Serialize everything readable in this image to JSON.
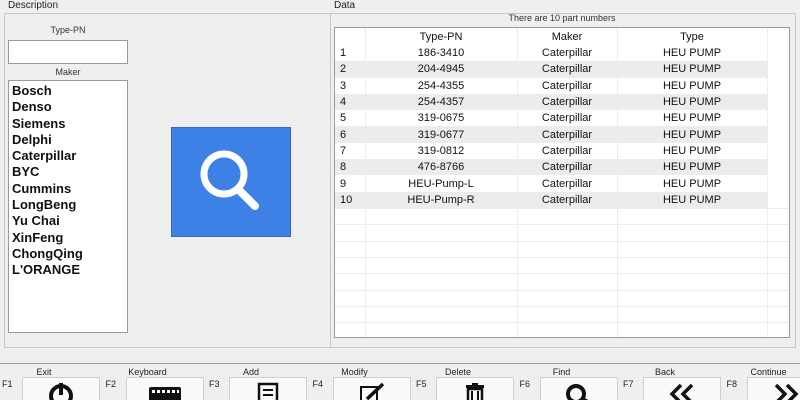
{
  "description_panel": {
    "title": "Description",
    "type_pn_label": "Type-PN",
    "type_pn_value": "",
    "maker_label": "Maker",
    "makers": [
      "Bosch",
      "Denso",
      "Siemens",
      "Delphi",
      "Caterpillar",
      "BYC",
      "Cummins",
      "LongBeng",
      "Yu Chai",
      "XinFeng",
      "ChongQing",
      "L'ORANGE"
    ]
  },
  "search_button": {
    "icon": "magnifier-icon",
    "color": "#3d80e6"
  },
  "data_panel": {
    "title": "Data",
    "count_text": "There are 10 part numbers",
    "columns": [
      "",
      "Type-PN",
      "Maker",
      "Type"
    ],
    "rows": [
      [
        "1",
        "186-3410",
        "Caterpillar",
        "HEU PUMP"
      ],
      [
        "2",
        "204-4945",
        "Caterpillar",
        "HEU PUMP"
      ],
      [
        "3",
        "254-4355",
        "Caterpillar",
        "HEU PUMP"
      ],
      [
        "4",
        "254-4357",
        "Caterpillar",
        "HEU PUMP"
      ],
      [
        "5",
        "319-0675",
        "Caterpillar",
        "HEU PUMP"
      ],
      [
        "6",
        "319-0677",
        "Caterpillar",
        "HEU PUMP"
      ],
      [
        "7",
        "319-0812",
        "Caterpillar",
        "HEU PUMP"
      ],
      [
        "8",
        "476-8766",
        "Caterpillar",
        "HEU PUMP"
      ],
      [
        "9",
        "HEU-Pump-L",
        "Caterpillar",
        "HEU PUMP"
      ],
      [
        "10",
        "HEU-Pump-R",
        "Caterpillar",
        "HEU PUMP"
      ]
    ]
  },
  "toolbar": {
    "buttons": [
      {
        "key": "F1",
        "label": "Exit",
        "icon": "power-icon"
      },
      {
        "key": "F2",
        "label": "Keyboard",
        "icon": "keyboard-icon"
      },
      {
        "key": "F3",
        "label": "Add",
        "icon": "add-list-icon"
      },
      {
        "key": "F4",
        "label": "Modify",
        "icon": "pencil-icon"
      },
      {
        "key": "F5",
        "label": "Delete",
        "icon": "trash-icon"
      },
      {
        "key": "F6",
        "label": "Find",
        "icon": "find-icon"
      },
      {
        "key": "F7",
        "label": "Back",
        "icon": "double-chevron-left-icon"
      },
      {
        "key": "F8",
        "label": "Continue",
        "icon": "double-chevron-right-icon"
      }
    ]
  }
}
